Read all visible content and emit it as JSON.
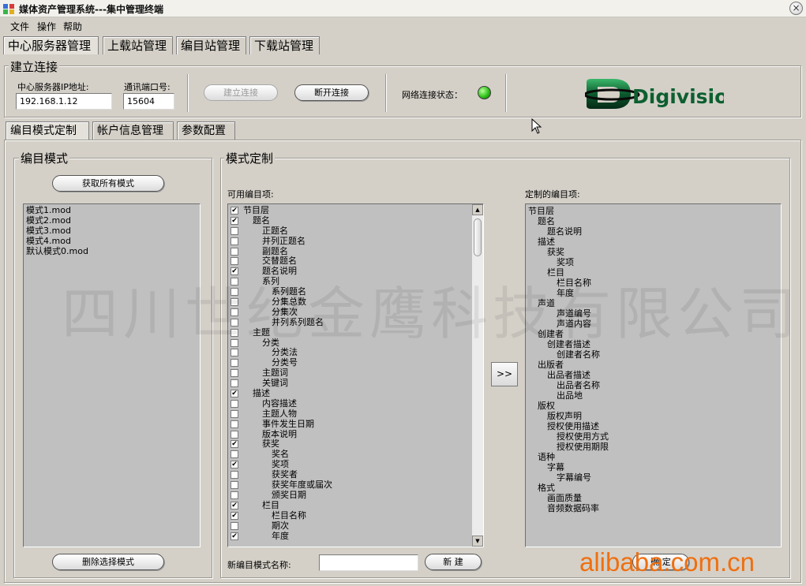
{
  "window": {
    "title": "媒体资产管理系统---集中管理终端",
    "close_glyph": "×"
  },
  "menu": [
    "文件",
    "操作",
    "帮助"
  ],
  "top_tabs": [
    "中心服务器管理",
    "上载站管理",
    "编目站管理",
    "下载站管理"
  ],
  "connection": {
    "group_title": "建立连接",
    "ip_label": "中心服务器IP地址:",
    "ip_value": "192.168.1.12",
    "port_label": "通讯端口号:",
    "port_value": "15604",
    "connect_button": "建立连接",
    "disconnect_button": "断开连接",
    "status_label": "网络连接状态：",
    "status_color": "#2fc21a",
    "logo_text": "Digivision"
  },
  "sub_tabs": [
    "编目模式定制",
    "帐户信息管理",
    "参数配置"
  ],
  "mode_panel": {
    "group_title": "编目模式",
    "get_all_button": "获取所有模式",
    "modes": [
      "模式1.mod",
      "模式2.mod",
      "模式3.mod",
      "模式4.mod",
      "默认模式0.mod"
    ],
    "delete_button": "删除选择模式"
  },
  "custom_panel": {
    "group_title": "模式定制",
    "available_label": "可用编目项:",
    "customized_label": "定制的编目项:",
    "transfer_button": ">>",
    "available_items": [
      {
        "label": "节目层",
        "checked": true,
        "level": 0
      },
      {
        "label": "题名",
        "checked": true,
        "level": 1
      },
      {
        "label": "正题名",
        "checked": false,
        "level": 2
      },
      {
        "label": "并列正题名",
        "checked": false,
        "level": 2
      },
      {
        "label": "副题名",
        "checked": false,
        "level": 2
      },
      {
        "label": "交替题名",
        "checked": false,
        "level": 2
      },
      {
        "label": "题名说明",
        "checked": true,
        "level": 2
      },
      {
        "label": "系列",
        "checked": false,
        "level": 2
      },
      {
        "label": "系列题名",
        "checked": false,
        "level": 3
      },
      {
        "label": "分集总数",
        "checked": false,
        "level": 3
      },
      {
        "label": "分集次",
        "checked": false,
        "level": 3
      },
      {
        "label": "并列系列题名",
        "checked": false,
        "level": 3
      },
      {
        "label": "主题",
        "checked": false,
        "level": 1
      },
      {
        "label": "分类",
        "checked": false,
        "level": 2
      },
      {
        "label": "分类法",
        "checked": false,
        "level": 3
      },
      {
        "label": "分类号",
        "checked": false,
        "level": 3
      },
      {
        "label": "主题词",
        "checked": false,
        "level": 2
      },
      {
        "label": "关键词",
        "checked": false,
        "level": 2
      },
      {
        "label": "描述",
        "checked": true,
        "level": 1
      },
      {
        "label": "内容描述",
        "checked": false,
        "level": 2
      },
      {
        "label": "主题人物",
        "checked": false,
        "level": 2
      },
      {
        "label": "事件发生日期",
        "checked": false,
        "level": 2
      },
      {
        "label": "版本说明",
        "checked": false,
        "level": 2
      },
      {
        "label": "获奖",
        "checked": true,
        "level": 2
      },
      {
        "label": "奖名",
        "checked": false,
        "level": 3
      },
      {
        "label": "奖项",
        "checked": true,
        "level": 3
      },
      {
        "label": "获奖者",
        "checked": false,
        "level": 3
      },
      {
        "label": "获奖年度或届次",
        "checked": false,
        "level": 3
      },
      {
        "label": "颁奖日期",
        "checked": false,
        "level": 3
      },
      {
        "label": "栏目",
        "checked": true,
        "level": 2
      },
      {
        "label": "栏目名称",
        "checked": true,
        "level": 3
      },
      {
        "label": "期次",
        "checked": false,
        "level": 3
      },
      {
        "label": "年度",
        "checked": true,
        "level": 3
      }
    ],
    "customized_items": [
      {
        "label": "节目层",
        "level": 0
      },
      {
        "label": "题名",
        "level": 1
      },
      {
        "label": "题名说明",
        "level": 2
      },
      {
        "label": "描述",
        "level": 1
      },
      {
        "label": "获奖",
        "level": 2
      },
      {
        "label": "奖项",
        "level": 3
      },
      {
        "label": "栏目",
        "level": 2
      },
      {
        "label": "栏目名称",
        "level": 3
      },
      {
        "label": "年度",
        "level": 3
      },
      {
        "label": "声道",
        "level": 1
      },
      {
        "label": "声道编号",
        "level": 3
      },
      {
        "label": "声道内容",
        "level": 3
      },
      {
        "label": "创建者",
        "level": 1
      },
      {
        "label": "创建者描述",
        "level": 2
      },
      {
        "label": "创建者名称",
        "level": 3
      },
      {
        "label": "出版者",
        "level": 1
      },
      {
        "label": "出品者描述",
        "level": 2
      },
      {
        "label": "出品者名称",
        "level": 3
      },
      {
        "label": "出品地",
        "level": 3
      },
      {
        "label": "版权",
        "level": 1
      },
      {
        "label": "版权声明",
        "level": 2
      },
      {
        "label": "授权使用描述",
        "level": 2
      },
      {
        "label": "授权使用方式",
        "level": 3
      },
      {
        "label": "授权使用期限",
        "level": 3
      },
      {
        "label": "语种",
        "level": 1
      },
      {
        "label": "字幕",
        "level": 2
      },
      {
        "label": "字幕编号",
        "level": 3
      },
      {
        "label": "格式",
        "level": 1
      },
      {
        "label": "画面质量",
        "level": 2
      },
      {
        "label": "音频数据码率",
        "level": 2
      }
    ],
    "new_mode_label": "新编目模式名称:",
    "new_mode_value": "",
    "new_button": "新 建",
    "confirm_button": "确 定"
  },
  "watermark_text": "四川世纪金鹰科技有限公司",
  "site_watermark": "alibaba.com.cn"
}
